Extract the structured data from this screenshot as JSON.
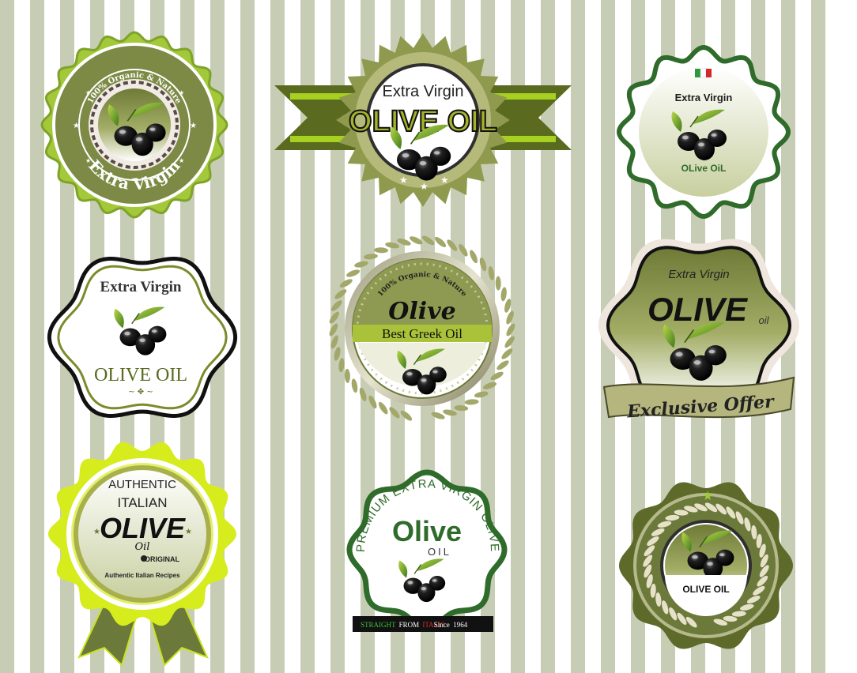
{
  "colors": {
    "stripe": "#c7cdb5",
    "olive_dark": "#6b7a3a",
    "olive_mid": "#8f9a4e",
    "forest": "#2f6b2a",
    "lime": "#c9e21c",
    "cream": "#efece2"
  },
  "badge1": {
    "arc_top": "100% Organic & Nature",
    "arc_bottom": "Extra Virgin"
  },
  "badge2": {
    "line1": "Extra Virgin",
    "line2": "OLIVE OIL"
  },
  "badge3": {
    "line1": "Extra Virgin",
    "line2": "OLive OiL",
    "flag": "italy-flag-icon"
  },
  "badge4": {
    "line1": "Extra Virgin",
    "line2": "OLIVE OIL"
  },
  "badge5": {
    "arc_top": "100% Organic & Nature",
    "script": "Olive",
    "band": "Best Greek Oil"
  },
  "badge6": {
    "line1": "Extra Virgin",
    "big": "OLIVE",
    "small": "oil",
    "ribbon": "Exclusive Offer"
  },
  "badge7": {
    "line1": "AUTHENTIC",
    "line2": "ITALIAN",
    "big": "OLIVE",
    "script": "Oil",
    "original": "ORIGINAL",
    "footer": "Authentic Italian Recipes"
  },
  "badge8": {
    "arc": "PREMIUM EXTRA VIRGIN OLIVE",
    "big": "Olive",
    "small": "OIL",
    "strip_a": "STRAIGHT",
    "strip_b": "FROM",
    "strip_c": "ITALY!",
    "strip_d": "Since  1964"
  },
  "badge9": {
    "label": "OLIVE OIL"
  }
}
